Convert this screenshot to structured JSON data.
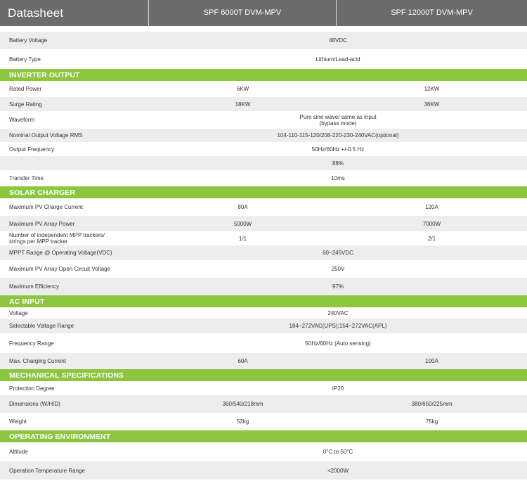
{
  "header": {
    "title": "Datasheet",
    "model_1": "SPF 6000T DVM-MPV",
    "model_2": "SPF 12000T DVM-MPV"
  },
  "general": [
    {
      "label": "Battery Voltage",
      "value": "48VDC"
    },
    {
      "label": "Battery Type",
      "value": "Lithium/Lead-acid"
    }
  ],
  "inverter_output": {
    "title": "INVERTER OUTPUT",
    "rated_power": {
      "label": "Rated Power",
      "v1": "6KW",
      "v2": "12KW"
    },
    "surge_rating": {
      "label": "Surge Rating",
      "v1": "18KW",
      "v2": "36KW"
    },
    "waveform": {
      "label": "Waveform",
      "value_line1": "Pure sine wave/ same as input",
      "value_line2": "(bypass mode)"
    },
    "nominal_voltage": {
      "label": "Nominal Output Voltage RMS",
      "value": "104-110-115-120/208-220-230-240VAC(optional)"
    },
    "output_frequency": {
      "label": "Output Frequency",
      "value": "50Hz/60Hz +/-0.5 Hz"
    },
    "efficiency": {
      "label": "",
      "value": "88%"
    },
    "transfer_time": {
      "label": "Transfer Time",
      "value": "10ms"
    }
  },
  "solar_charger": {
    "title": "SOLAR CHARGER",
    "max_pv_current": {
      "label": "Maximum PV Charge Current",
      "v1": "80A",
      "v2": "120A"
    },
    "max_pv_power": {
      "label": "Maximum PV Array Power",
      "v1": "5000W",
      "v2": "7000W"
    },
    "mpp_trackers": {
      "label_line1": "Number of independent MPP trackers/",
      "label_line2": "strings per MPP tracker",
      "v1": "1/1",
      "v2": "2/1"
    },
    "mppt_range": {
      "label": "MPPT Range @ Operating Voltage(VDC)",
      "value": "60~245VDC"
    },
    "open_circuit": {
      "label": "Maximum PV Array Open Circuit Voltage",
      "value": "250V"
    },
    "max_efficiency": {
      "label": "Maximum Efficiency",
      "value": "97%"
    }
  },
  "ac_input": {
    "title": "AC INPUT",
    "voltage": {
      "label": "Voltage",
      "value": "240VAC"
    },
    "voltage_range": {
      "label": "Selectable Voltage Range",
      "value": "184~272VAC(UPS);154~272VAC(APL)"
    },
    "frequency_range": {
      "label": "Frequency Range",
      "value": "50Hz/60Hz (Auto sensing)"
    },
    "charging_current": {
      "label": "Max. Charging Current",
      "v1": "60A",
      "v2": "100A"
    }
  },
  "mechanical": {
    "title": "MECHANICAL SPECIFICATIONS",
    "protection": {
      "label": "Protection Degree",
      "value": "IP20"
    },
    "dimensions": {
      "label": "Dimensions (W/H/D)",
      "v1": "360/540/218mm",
      "v2": "380/650/225mm"
    },
    "weight": {
      "label": "Weight",
      "v1": "52kg",
      "v2": "75kg"
    }
  },
  "environment": {
    "title": "OPERATING ENVIRONMENT",
    "altitude": {
      "label": "Altitude",
      "value": "0°C to 50°C"
    },
    "temperature": {
      "label": "Operation Temperature Range",
      "value": "<2000W"
    }
  }
}
